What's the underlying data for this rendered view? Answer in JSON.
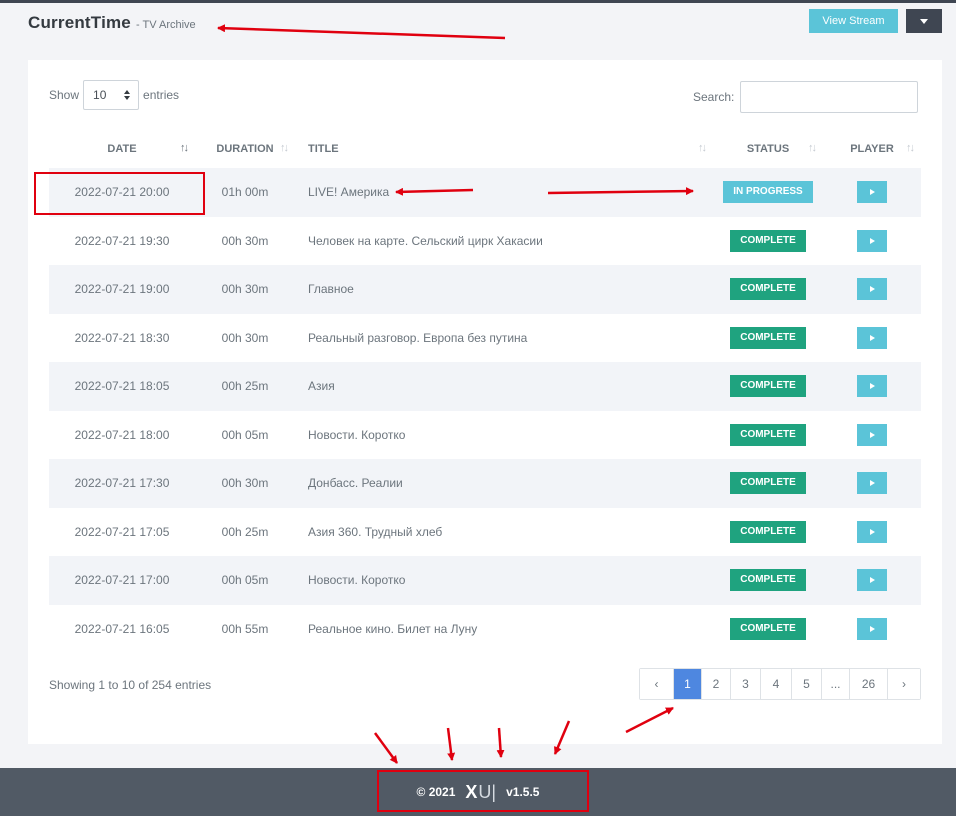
{
  "header": {
    "title": "CurrentTime",
    "subtitle": "- TV Archive",
    "view_stream_label": "View Stream"
  },
  "controls": {
    "show_label": "Show",
    "entries_value": "10",
    "entries_label": "entries",
    "search_label": "Search:",
    "search_value": ""
  },
  "table": {
    "columns": [
      "DATE",
      "DURATION",
      "TITLE",
      "STATUS",
      "PLAYER"
    ],
    "sort_glyph": "↑↓",
    "rows": [
      {
        "date": "2022-07-21 20:00",
        "duration": "01h 00m",
        "title": "LIVE! Америка",
        "status": "IN PROGRESS"
      },
      {
        "date": "2022-07-21 19:30",
        "duration": "00h 30m",
        "title": "Человек на карте. Сельский цирк Хакасии",
        "status": "COMPLETE"
      },
      {
        "date": "2022-07-21 19:00",
        "duration": "00h 30m",
        "title": "Главное",
        "status": "COMPLETE"
      },
      {
        "date": "2022-07-21 18:30",
        "duration": "00h 30m",
        "title": "Реальный разговор. Европа без путина",
        "status": "COMPLETE"
      },
      {
        "date": "2022-07-21 18:05",
        "duration": "00h 25m",
        "title": "Азия",
        "status": "COMPLETE"
      },
      {
        "date": "2022-07-21 18:00",
        "duration": "00h 05m",
        "title": "Новости. Коротко",
        "status": "COMPLETE"
      },
      {
        "date": "2022-07-21 17:30",
        "duration": "00h 30m",
        "title": "Донбасс. Реалии",
        "status": "COMPLETE"
      },
      {
        "date": "2022-07-21 17:05",
        "duration": "00h 25m",
        "title": "Азия 360. Трудный хлеб",
        "status": "COMPLETE"
      },
      {
        "date": "2022-07-21 17:00",
        "duration": "00h 05m",
        "title": "Новости. Коротко",
        "status": "COMPLETE"
      },
      {
        "date": "2022-07-21 16:05",
        "duration": "00h 55m",
        "title": "Реальное кино. Билет на Луну",
        "status": "COMPLETE"
      }
    ]
  },
  "pagination": {
    "info": "Showing 1 to 10 of 254 entries",
    "prev": "‹",
    "next": "›",
    "pages": [
      "1",
      "2",
      "3",
      "4",
      "5",
      "...",
      "26"
    ],
    "active_page": "1"
  },
  "footer": {
    "copyright": "© 2021",
    "logo_x": "X",
    "logo_rest": "U|",
    "version": "v1.5.5"
  },
  "colors": {
    "accent": "#5bc4d8",
    "complete": "#1fa37f",
    "active_page": "#4e87e0",
    "dark": "#3f4652",
    "annotation": "#e0000f"
  }
}
